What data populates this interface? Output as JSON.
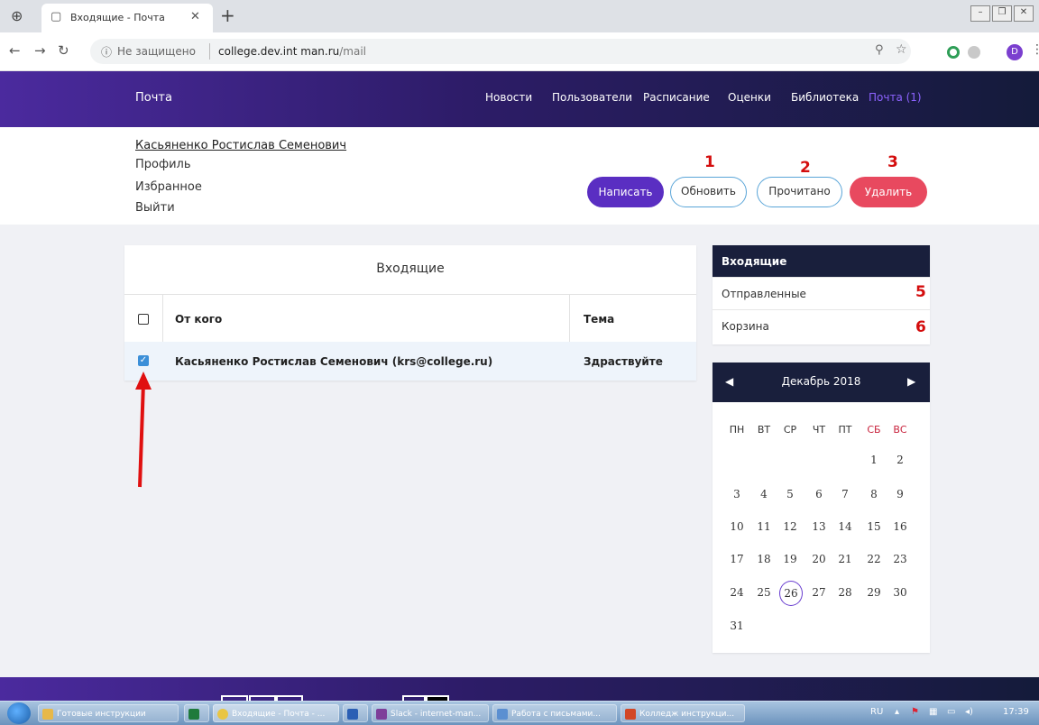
{
  "browser": {
    "tab_title": "Входящие - Почта",
    "url_insecure": "Не защищено",
    "url_host": "college.dev.int man.ru",
    "url_path": "/mail"
  },
  "site": {
    "brand": "Почта",
    "menu": [
      "Новости",
      "Пользователи",
      "Расписание",
      "Оценки",
      "Библиотека",
      "Почта (1)"
    ]
  },
  "user": {
    "name": "Касьяненко Ростислав Семенович",
    "links": [
      "Профиль",
      "Избранное",
      "Выйти"
    ]
  },
  "toolbar": {
    "write": "Написать",
    "refresh": "Обновить",
    "read": "Прочитано",
    "delete": "Удалить"
  },
  "annotations": {
    "refresh": "1",
    "read": "2",
    "delete": "3",
    "sent": "5",
    "trash": "6"
  },
  "inbox": {
    "title": "Входящие",
    "col_from": "От кого",
    "col_subject": "Тема",
    "rows": [
      {
        "from": "Касьяненко Ростислав Семенович (krs@college.ru)",
        "subject": "Здраствуйте",
        "checked": true
      }
    ]
  },
  "folders": [
    "Входящие",
    "Отправленные",
    "Корзина"
  ],
  "calendar": {
    "month": "Декабрь 2018",
    "weekdays": [
      "ПН",
      "ВТ",
      "СР",
      "ЧТ",
      "ПТ",
      "СБ",
      "ВС"
    ],
    "weeks": [
      [
        "",
        "",
        "",
        "",
        "",
        "1",
        "2"
      ],
      [
        "3",
        "4",
        "5",
        "6",
        "7",
        "8",
        "9"
      ],
      [
        "10",
        "11",
        "12",
        "13",
        "14",
        "15",
        "16"
      ],
      [
        "17",
        "18",
        "19",
        "20",
        "21",
        "22",
        "23"
      ],
      [
        "24",
        "25",
        "26",
        "27",
        "28",
        "29",
        "30"
      ],
      [
        "31",
        "",
        "",
        "",
        "",
        "",
        ""
      ]
    ],
    "today": "26"
  },
  "taskbar": {
    "items": [
      "Готовые инструкции",
      "",
      "Входящие - Почта - ...",
      "",
      "Slack - internet-man...",
      "Работа с письмами...",
      "Колледж инструкци..."
    ],
    "lang": "RU",
    "time": "17:39"
  }
}
